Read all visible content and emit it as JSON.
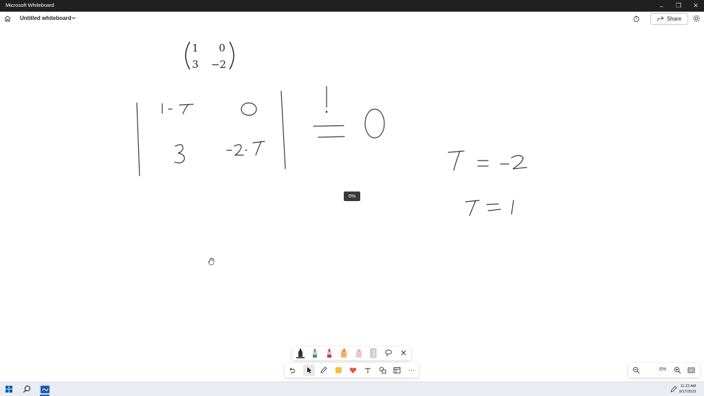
{
  "window": {
    "title": "Microsoft Whiteboard",
    "minimize_glyph": "–",
    "restore_glyph": "❐",
    "close_glyph": "✕"
  },
  "appbar": {
    "board_title": "Untitled whiteboard",
    "share_label": "Share",
    "icons": [
      "home-icon",
      "chevron-down-icon",
      "timer-icon",
      "share-icon",
      "gear-icon"
    ]
  },
  "canvas": {
    "matrix": {
      "row1": [
        "1",
        "0"
      ],
      "row2": [
        "3",
        "−2"
      ]
    },
    "handwriting": {
      "determinant_entries": [
        "1-λ",
        "0",
        "3",
        "-2-λ"
      ],
      "equals_rhs": "0",
      "root1": "λ = -2",
      "root2": "λ = 1"
    },
    "zoom_tooltip": "6%"
  },
  "ink_tray": {
    "tools": [
      "black-pen",
      "green-pen",
      "red-pen",
      "orange-highlighter",
      "pink-highlighter",
      "ruler",
      "lasso",
      "close"
    ],
    "colors": {
      "black": "#111111",
      "green": "#2e9e47",
      "red": "#d52b2b",
      "orange": "#f08a24",
      "pink": "#f39ab3"
    }
  },
  "toolbar": {
    "more_glyph": "···",
    "items": [
      "undo-icon",
      "select-icon",
      "inking-icon",
      "sticky-note-icon",
      "reaction-icon",
      "text-icon",
      "shapes-icon",
      "templates-icon",
      "more-icon"
    ]
  },
  "zoom": {
    "level": "6%"
  },
  "taskbar": {
    "time": "11:23 AM",
    "date": "8/17/2023"
  }
}
